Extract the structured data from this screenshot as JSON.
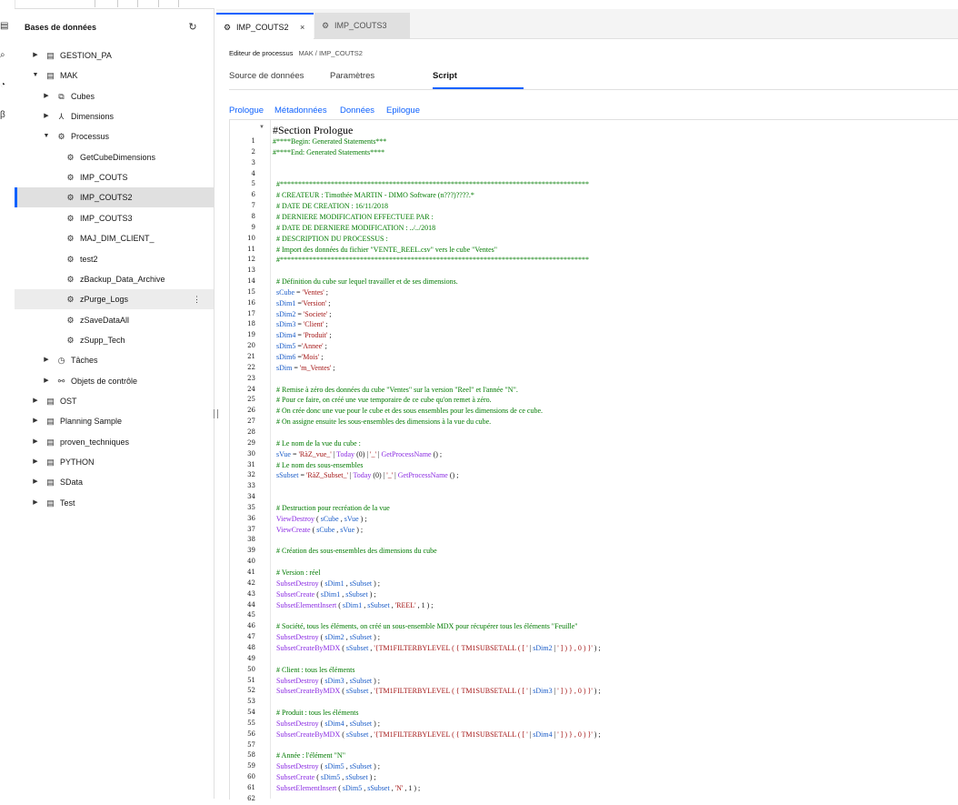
{
  "sidebar": {
    "heading": "Bases de données",
    "refresh_icon": "refresh-icon",
    "items": [
      {
        "label": "GESTION_PA",
        "level": 0,
        "caret": "right",
        "icon": "database-icon"
      },
      {
        "label": "MAK",
        "level": 0,
        "caret": "down",
        "icon": "database-icon"
      },
      {
        "label": "Cubes",
        "level": 1,
        "caret": "right",
        "icon": "cubes-icon"
      },
      {
        "label": "Dimensions",
        "level": 1,
        "caret": "right",
        "icon": "dimensions-icon"
      },
      {
        "label": "Processus",
        "level": 1,
        "caret": "down",
        "icon": "process-icon"
      },
      {
        "label": "GetCubeDimensions",
        "level": 2,
        "icon": "process-icon"
      },
      {
        "label": "IMP_COUTS",
        "level": 2,
        "icon": "process-icon"
      },
      {
        "label": "IMP_COUTS2",
        "level": 2,
        "icon": "process-icon",
        "selected": true
      },
      {
        "label": "IMP_COUTS3",
        "level": 2,
        "icon": "process-icon"
      },
      {
        "label": "MAJ_DIM_CLIENT_",
        "level": 2,
        "icon": "process-icon"
      },
      {
        "label": "test2",
        "level": 2,
        "icon": "process-icon"
      },
      {
        "label": "zBackup_Data_Archive",
        "level": 2,
        "icon": "process-icon"
      },
      {
        "label": "zPurge_Logs",
        "level": 2,
        "icon": "process-icon",
        "hover": true
      },
      {
        "label": "zSaveDataAll",
        "level": 2,
        "icon": "process-icon"
      },
      {
        "label": "zSupp_Tech",
        "level": 2,
        "icon": "process-icon"
      },
      {
        "label": "Tâches",
        "level": 1,
        "caret": "right",
        "icon": "clock-icon"
      },
      {
        "label": "Objets de contrôle",
        "level": 1,
        "caret": "right",
        "icon": "control-objects-icon"
      },
      {
        "label": "OST",
        "level": 0,
        "caret": "right",
        "icon": "database-icon"
      },
      {
        "label": "Planning Sample",
        "level": 0,
        "caret": "right",
        "icon": "database-icon"
      },
      {
        "label": "proven_techniques",
        "level": 0,
        "caret": "right",
        "icon": "database-icon"
      },
      {
        "label": "PYTHON",
        "level": 0,
        "caret": "right",
        "icon": "database-icon"
      },
      {
        "label": "SData",
        "level": 0,
        "caret": "right",
        "icon": "database-icon"
      },
      {
        "label": "Test",
        "level": 0,
        "caret": "right",
        "icon": "database-icon"
      }
    ]
  },
  "tabs": [
    {
      "label": "IMP_COUTS2",
      "active": true,
      "close": "×"
    },
    {
      "label": "IMP_COUTS3",
      "active": false
    }
  ],
  "editor": {
    "title": "Editeur de processus",
    "path": "MAK / IMP_COUTS2",
    "subtabs": [
      "Source de données",
      "Paramètres",
      "Script"
    ],
    "active_subtab": "Script",
    "sections": [
      "Prologue",
      "Métadonnées",
      "Données",
      "Epilogue"
    ],
    "section_title": "#Section Prologue",
    "lines": [
      [
        [
          "c",
          "#****Begin: Generated Statements***"
        ]
      ],
      [
        [
          "c",
          "#****End: Generated Statements****"
        ]
      ],
      [],
      [],
      [
        [
          "c",
          "  #*************************************************************************************"
        ]
      ],
      [
        [
          "c",
          "  # CREATEUR : Timothée MARTIN - DIMO Software (n???)????.*"
        ]
      ],
      [
        [
          "c",
          "  # DATE DE CREATION : 16/11/2018"
        ]
      ],
      [
        [
          "c",
          "  # DERNIERE MODIFICATION EFFECTUEE PAR :"
        ]
      ],
      [
        [
          "c",
          "  # DATE DE DERNIERE MODIFICATION : ../../2018"
        ]
      ],
      [
        [
          "c",
          "  # DESCRIPTION DU PROCESSUS :"
        ]
      ],
      [
        [
          "c",
          "  # Import des données du fichier \"VENTE_REEL.csv\" vers le cube \"Ventes\""
        ]
      ],
      [
        [
          "c",
          "  #*************************************************************************************"
        ]
      ],
      [],
      [
        [
          "c",
          "  # Définition du cube sur lequel travailler et de ses dimensions."
        ]
      ],
      [
        [
          "v",
          "  sCube"
        ],
        [
          "p",
          " = "
        ],
        [
          "s",
          "'Ventes'"
        ],
        [
          "p",
          " ;"
        ]
      ],
      [
        [
          "v",
          "  sDim1"
        ],
        [
          "p",
          " ="
        ],
        [
          "s",
          "'Version'"
        ],
        [
          "p",
          " ;"
        ]
      ],
      [
        [
          "v",
          "  sDim2"
        ],
        [
          "p",
          " = "
        ],
        [
          "s",
          "'Societe'"
        ],
        [
          "p",
          " ;"
        ]
      ],
      [
        [
          "v",
          "  sDim3"
        ],
        [
          "p",
          " = "
        ],
        [
          "s",
          "'Client'"
        ],
        [
          "p",
          " ;"
        ]
      ],
      [
        [
          "v",
          "  sDim4"
        ],
        [
          "p",
          " = "
        ],
        [
          "s",
          "'Produit'"
        ],
        [
          "p",
          " ;"
        ]
      ],
      [
        [
          "v",
          "  sDim5"
        ],
        [
          "p",
          " ="
        ],
        [
          "s",
          "'Annee'"
        ],
        [
          "p",
          " ;"
        ]
      ],
      [
        [
          "v",
          "  sDim6"
        ],
        [
          "p",
          " ="
        ],
        [
          "s",
          "'Mois'"
        ],
        [
          "p",
          " ;"
        ]
      ],
      [
        [
          "v",
          "  sDim"
        ],
        [
          "p",
          " = "
        ],
        [
          "s",
          "'m_Ventes'"
        ],
        [
          "p",
          " ;"
        ]
      ],
      [],
      [
        [
          "c",
          "  # Remise à zéro des données du cube \"Ventes\" sur la version \"Reel\" et l'année \"N\"."
        ]
      ],
      [
        [
          "c",
          "  # Pour ce faire, on créé une vue temporaire de ce cube qu'on remet à zéro."
        ]
      ],
      [
        [
          "c",
          "  # On crée donc une vue pour le cube et des sous ensembles pour les dimensions de ce cube."
        ]
      ],
      [
        [
          "c",
          "  # On assigne ensuite les sous-ensembles des dimensions à la vue du cube."
        ]
      ],
      [],
      [
        [
          "c",
          "  # Le nom de la vue du cube :"
        ]
      ],
      [
        [
          "v",
          "  sVue"
        ],
        [
          "p",
          " = "
        ],
        [
          "s",
          "'RàZ_vue_'"
        ],
        [
          "p",
          " | "
        ],
        [
          "f",
          "Today"
        ],
        [
          "p",
          " (0) | "
        ],
        [
          "s",
          "'_'"
        ],
        [
          "p",
          " | "
        ],
        [
          "f",
          "GetProcessName"
        ],
        [
          "p",
          " () ;"
        ]
      ],
      [
        [
          "c",
          "  # Le nom des sous-ensembles"
        ]
      ],
      [
        [
          "v",
          "  sSubset"
        ],
        [
          "p",
          " = "
        ],
        [
          "s",
          "'RàZ_Subset_'"
        ],
        [
          "p",
          " | "
        ],
        [
          "f",
          "Today"
        ],
        [
          "p",
          " (0) | "
        ],
        [
          "s",
          "'_'"
        ],
        [
          "p",
          " | "
        ],
        [
          "f",
          "GetProcessName"
        ],
        [
          "p",
          " () ;"
        ]
      ],
      [],
      [],
      [
        [
          "c",
          "  # Destruction pour recréation de la vue"
        ]
      ],
      [
        [
          "f",
          "  ViewDestroy"
        ],
        [
          "p",
          " ( "
        ],
        [
          "v",
          "sCube"
        ],
        [
          "p",
          " , "
        ],
        [
          "v",
          "sVue"
        ],
        [
          "p",
          " ) ;"
        ]
      ],
      [
        [
          "f",
          "  ViewCreate"
        ],
        [
          "p",
          " ( "
        ],
        [
          "v",
          "sCube"
        ],
        [
          "p",
          " , "
        ],
        [
          "v",
          "sVue"
        ],
        [
          "p",
          " ) ;"
        ]
      ],
      [],
      [
        [
          "c",
          "  # Création des sous-ensembles des dimensions du cube"
        ]
      ],
      [],
      [
        [
          "c",
          "  # Version : réel"
        ]
      ],
      [
        [
          "f",
          "  SubsetDestroy"
        ],
        [
          "p",
          " ( "
        ],
        [
          "v",
          "sDim1"
        ],
        [
          "p",
          " , "
        ],
        [
          "v",
          "sSubset"
        ],
        [
          "p",
          " ) ;"
        ]
      ],
      [
        [
          "f",
          "  SubsetCreate"
        ],
        [
          "p",
          " ( "
        ],
        [
          "v",
          "sDim1"
        ],
        [
          "p",
          " , "
        ],
        [
          "v",
          "sSubset"
        ],
        [
          "p",
          " ) ;"
        ]
      ],
      [
        [
          "f",
          "  SubsetElementInsert"
        ],
        [
          "p",
          " ( "
        ],
        [
          "v",
          "sDim1"
        ],
        [
          "p",
          " , "
        ],
        [
          "v",
          "sSubset"
        ],
        [
          "p",
          " , "
        ],
        [
          "s",
          "'REEL'"
        ],
        [
          "p",
          " , 1 ) ;"
        ]
      ],
      [],
      [
        [
          "c",
          "  # Société, tous les éléments, on créé un sous-ensemble MDX pour récupérer tous les éléments \"Feuille\""
        ]
      ],
      [
        [
          "f",
          "  SubsetDestroy"
        ],
        [
          "p",
          " ( "
        ],
        [
          "v",
          "sDim2"
        ],
        [
          "p",
          " , "
        ],
        [
          "v",
          "sSubset"
        ],
        [
          "p",
          " ) ;"
        ]
      ],
      [
        [
          "f",
          "  SubsetCreateByMDX"
        ],
        [
          "p",
          " ( "
        ],
        [
          "v",
          "sSubset"
        ],
        [
          "p",
          " , "
        ],
        [
          "s",
          "'{TM1FILTERBYLEVEL ( { TM1SUBSETALL ( [ '"
        ],
        [
          "p",
          " | "
        ],
        [
          "v",
          "sDim2"
        ],
        [
          "p",
          " | "
        ],
        [
          "s",
          "' ] ) } , 0 ) }'"
        ],
        [
          "p",
          " ) ;"
        ]
      ],
      [],
      [
        [
          "c",
          "  # Client : tous les éléments"
        ]
      ],
      [
        [
          "f",
          "  SubsetDestroy"
        ],
        [
          "p",
          " ( "
        ],
        [
          "v",
          "sDim3"
        ],
        [
          "p",
          " , "
        ],
        [
          "v",
          "sSubset"
        ],
        [
          "p",
          " ) ;"
        ]
      ],
      [
        [
          "f",
          "  SubsetCreateByMDX"
        ],
        [
          "p",
          " ( "
        ],
        [
          "v",
          "sSubset"
        ],
        [
          "p",
          " , "
        ],
        [
          "s",
          "'{TM1FILTERBYLEVEL ( { TM1SUBSETALL ( [ '"
        ],
        [
          "p",
          " | "
        ],
        [
          "v",
          "sDim3"
        ],
        [
          "p",
          " | "
        ],
        [
          "s",
          "' ] ) } , 0 ) }'"
        ],
        [
          "p",
          " ) ;"
        ]
      ],
      [],
      [
        [
          "c",
          "  # Produit : tous les éléments"
        ]
      ],
      [
        [
          "f",
          "  SubsetDestroy"
        ],
        [
          "p",
          " ( "
        ],
        [
          "v",
          "sDim4"
        ],
        [
          "p",
          " , "
        ],
        [
          "v",
          "sSubset"
        ],
        [
          "p",
          " ) ;"
        ]
      ],
      [
        [
          "f",
          "  SubsetCreateByMDX"
        ],
        [
          "p",
          " ( "
        ],
        [
          "v",
          "sSubset"
        ],
        [
          "p",
          " , "
        ],
        [
          "s",
          "'{TM1FILTERBYLEVEL ( { TM1SUBSETALL ( [ '"
        ],
        [
          "p",
          " | "
        ],
        [
          "v",
          "sDim4"
        ],
        [
          "p",
          " | "
        ],
        [
          "s",
          "' ] ) } , 0 ) }'"
        ],
        [
          "p",
          " ) ;"
        ]
      ],
      [],
      [
        [
          "c",
          "  # Année : l'élément \"N\""
        ]
      ],
      [
        [
          "f",
          "  SubsetDestroy"
        ],
        [
          "p",
          " ( "
        ],
        [
          "v",
          "sDim5"
        ],
        [
          "p",
          " , "
        ],
        [
          "v",
          "sSubset"
        ],
        [
          "p",
          " ) ;"
        ]
      ],
      [
        [
          "f",
          "  SubsetCreate"
        ],
        [
          "p",
          " ( "
        ],
        [
          "v",
          "sDim5"
        ],
        [
          "p",
          " , "
        ],
        [
          "v",
          "sSubset"
        ],
        [
          "p",
          " ) ;"
        ]
      ],
      [
        [
          "f",
          "  SubsetElementInsert"
        ],
        [
          "p",
          " ( "
        ],
        [
          "v",
          "sDim5"
        ],
        [
          "p",
          " , "
        ],
        [
          "v",
          "sSubset"
        ],
        [
          "p",
          " , "
        ],
        [
          "s",
          "'N'"
        ],
        [
          "p",
          " , 1 ) ;"
        ]
      ],
      []
    ]
  },
  "colors": {
    "accent": "#0f62fe",
    "comment": "#007a00",
    "variable": "#1a5cc8",
    "function": "#8a2be2",
    "string": "#a31515"
  }
}
